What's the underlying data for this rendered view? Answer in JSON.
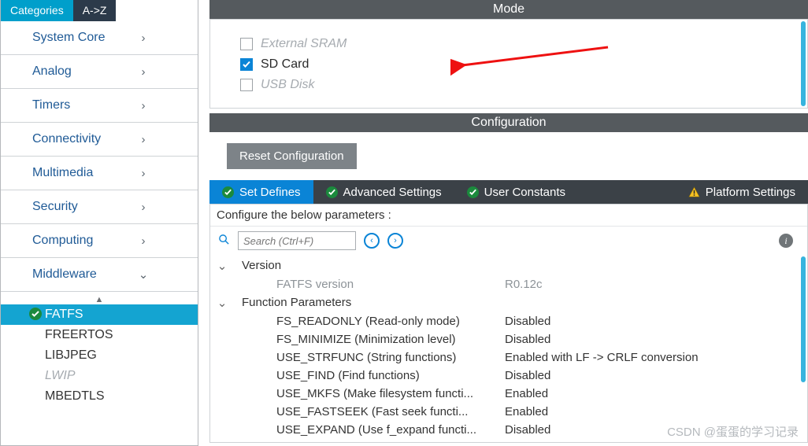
{
  "sidebar": {
    "tabs": {
      "categories": "Categories",
      "az": "A->Z"
    },
    "cats": [
      {
        "label": "System Core",
        "open": false
      },
      {
        "label": "Analog",
        "open": false
      },
      {
        "label": "Timers",
        "open": false
      },
      {
        "label": "Connectivity",
        "open": false
      },
      {
        "label": "Multimedia",
        "open": false
      },
      {
        "label": "Security",
        "open": false
      },
      {
        "label": "Computing",
        "open": false
      },
      {
        "label": "Middleware",
        "open": true
      }
    ],
    "middleware_items": [
      {
        "label": "FATFS",
        "state": "selected"
      },
      {
        "label": "FREERTOS",
        "state": "normal"
      },
      {
        "label": "LIBJPEG",
        "state": "normal"
      },
      {
        "label": "LWIP",
        "state": "disabled"
      },
      {
        "label": "MBEDTLS",
        "state": "normal"
      }
    ]
  },
  "mode": {
    "header": "Mode",
    "options": [
      {
        "label": "External SRAM",
        "checked": false,
        "enabled": false
      },
      {
        "label": "SD Card",
        "checked": true,
        "enabled": true
      },
      {
        "label": "USB Disk",
        "checked": false,
        "enabled": false
      }
    ]
  },
  "config": {
    "header": "Configuration",
    "reset_btn": "Reset Configuration",
    "tabs": {
      "set_defines": "Set Defines",
      "advanced": "Advanced Settings",
      "user_const": "User Constants",
      "platform": "Platform Settings"
    },
    "area_title": "Configure the below parameters :",
    "search_placeholder": "Search (Ctrl+F)",
    "groups": [
      {
        "name": "Version",
        "rows": [
          {
            "label": "FATFS version",
            "value": "R0.12c",
            "grey": true
          }
        ]
      },
      {
        "name": "Function Parameters",
        "rows": [
          {
            "label": "FS_READONLY (Read-only mode)",
            "value": "Disabled"
          },
          {
            "label": "FS_MINIMIZE (Minimization level)",
            "value": "Disabled"
          },
          {
            "label": "USE_STRFUNC (String functions)",
            "value": "Enabled with LF -> CRLF conversion"
          },
          {
            "label": "USE_FIND (Find functions)",
            "value": "Disabled"
          },
          {
            "label": "USE_MKFS (Make filesystem functi...",
            "value": "Enabled"
          },
          {
            "label": "USE_FASTSEEK (Fast seek functi...",
            "value": "Enabled"
          },
          {
            "label": "USE_EXPAND (Use f_expand functi...",
            "value": "Disabled"
          }
        ]
      }
    ]
  },
  "watermark": "CSDN @蛋蛋的学习记录"
}
